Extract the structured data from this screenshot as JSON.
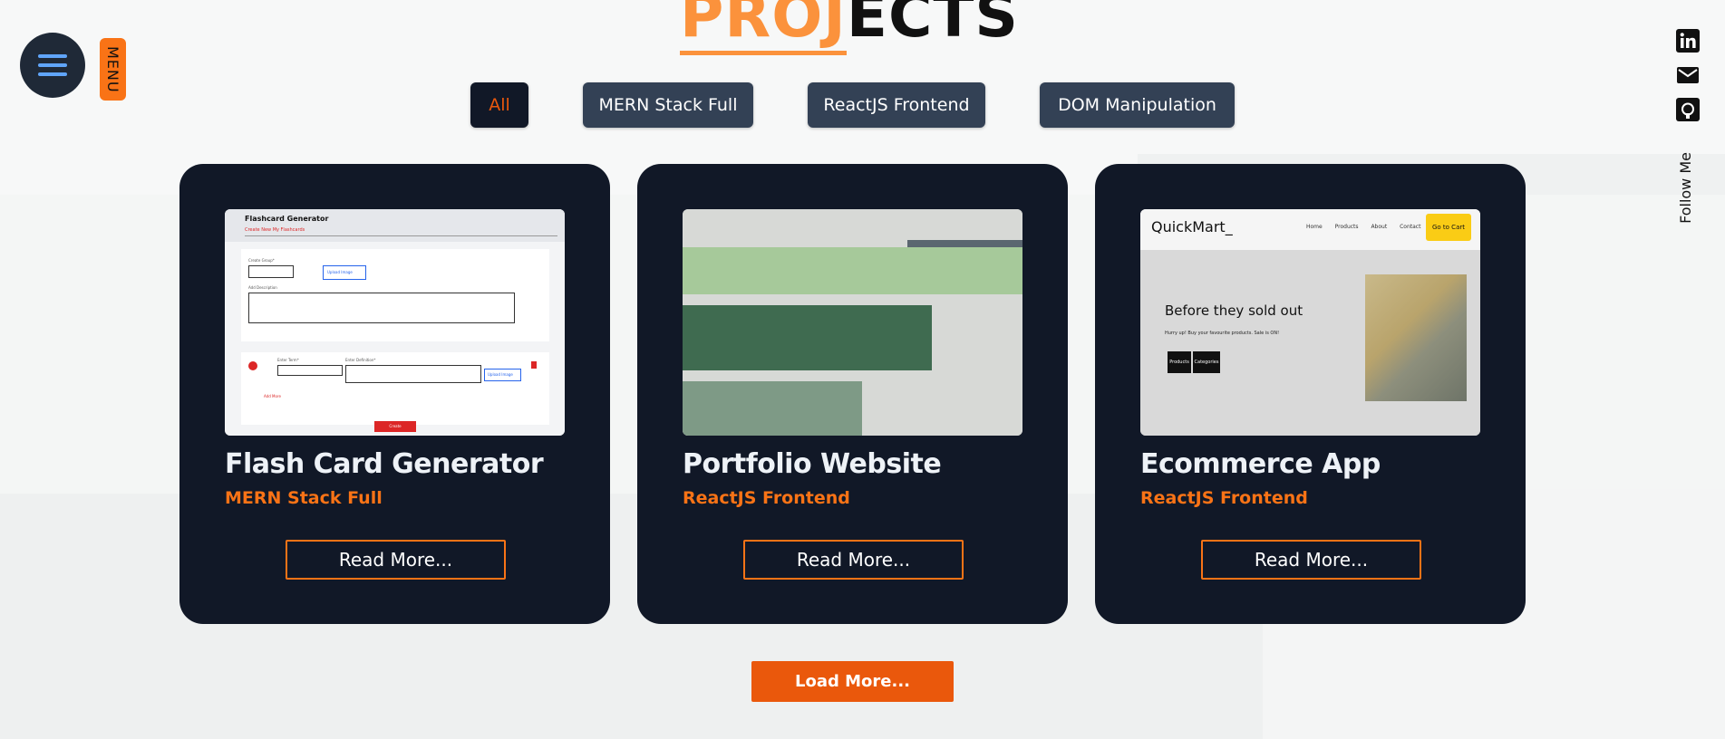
{
  "page": {
    "heading_highlight": "PROJ",
    "heading_rest": "ECTS"
  },
  "menu": {
    "label": "MENU",
    "icon": "hamburger-icon"
  },
  "filters": [
    {
      "label": "All",
      "active": true
    },
    {
      "label": "MERN Stack Full",
      "active": false
    },
    {
      "label": "ReactJS Frontend",
      "active": false
    },
    {
      "label": "DOM Manipulation",
      "active": false
    }
  ],
  "social": {
    "icons": [
      "linkedin-icon",
      "mail-icon",
      "github-icon"
    ],
    "follow_label": "Follow Me"
  },
  "projects": [
    {
      "title": "Flash Card Generator",
      "category": "MERN Stack Full",
      "read_more": "Read More...",
      "thumb": {
        "app_title": "Flashcard Generator",
        "tabs": "Create New   My Flashcards",
        "create_group": "Create Group*",
        "upload_image": "Upload Image",
        "add_description": "Add Description",
        "enter_term": "Enter Term*",
        "enter_definition": "Enter Definition*",
        "add_more": "Add More",
        "create": "Create"
      }
    },
    {
      "title": "Portfolio Website",
      "category": "ReactJS Frontend",
      "read_more": "Read More..."
    },
    {
      "title": "Ecommerce App",
      "category": "ReactJS Frontend",
      "read_more": "Read More...",
      "thumb": {
        "logo": "QuickMart_",
        "links": "Home Products About Contact",
        "cart": "Go to Cart",
        "hero": "Before they sold out",
        "sub": "Hurry up! Buy your favourite products. Sale is ON!",
        "btn1": "Products",
        "btn2": "Categories"
      }
    }
  ],
  "load_more": "Load More...",
  "colors": {
    "accent": "#f97316",
    "accent_dark": "#ea580c",
    "card_bg": "#111827",
    "filter_bg": "#334155",
    "heading_highlight": "#fb923c"
  }
}
